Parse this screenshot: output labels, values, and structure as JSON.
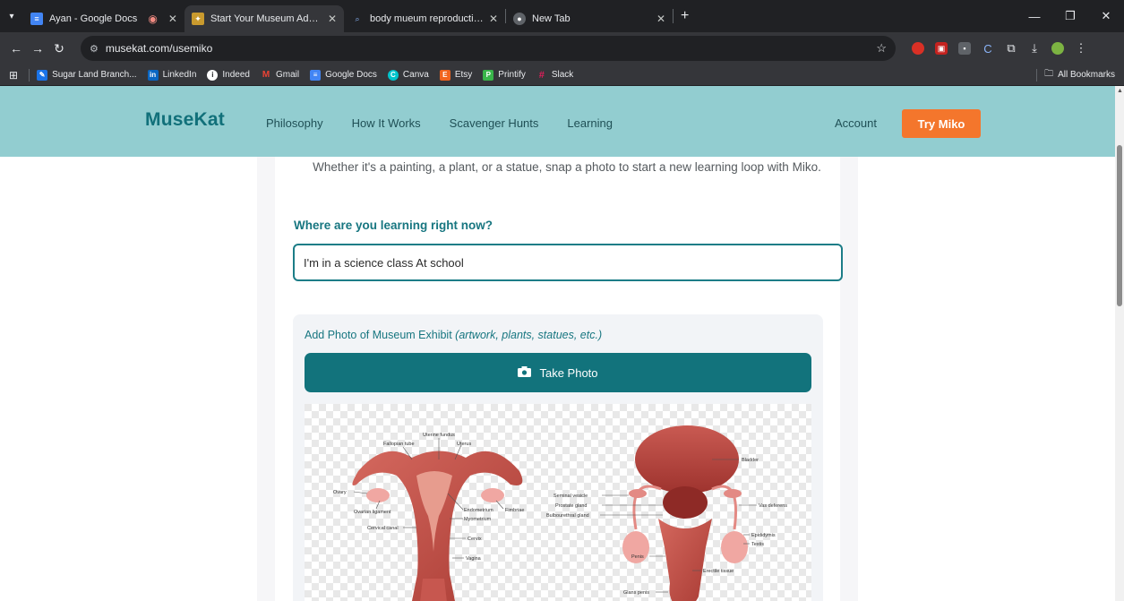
{
  "browser": {
    "tabs": [
      {
        "title": "Ayan - Google Docs",
        "favicon_color": "#4285f4",
        "active": false,
        "recording": true
      },
      {
        "title": "Start Your Museum Adventure",
        "favicon_color": "#c99a2e",
        "active": true
      },
      {
        "title": "body mueum reproductive orga",
        "favicon_color": "#8ab4f8",
        "active": false
      },
      {
        "title": "New Tab",
        "favicon_color": "#9aa0a6",
        "active": false
      }
    ],
    "url": "musekat.com/usemiko",
    "bookmarks": [
      {
        "label": "Sugar Land Branch...",
        "color": "#1a73e8"
      },
      {
        "label": "LinkedIn",
        "color": "#0a66c2"
      },
      {
        "label": "Indeed",
        "color": "#2164f3"
      },
      {
        "label": "Gmail",
        "color": "#ea4335"
      },
      {
        "label": "Google Docs",
        "color": "#4285f4"
      },
      {
        "label": "Canva",
        "color": "#00c4cc"
      },
      {
        "label": "Etsy",
        "color": "#f1641e"
      },
      {
        "label": "Printify",
        "color": "#39b54a"
      },
      {
        "label": "Slack",
        "color": "#e01e5a"
      }
    ],
    "all_bookmarks": "All Bookmarks"
  },
  "site": {
    "logo": "MuseKat",
    "nav": [
      "Philosophy",
      "How It Works",
      "Scavenger Hunts",
      "Learning"
    ],
    "account": "Account",
    "cta": "Try Miko",
    "colors": {
      "header": "#92cdd0",
      "cta": "#f4762c",
      "teal": "#12737c"
    }
  },
  "main": {
    "subtitle": "Whether it's a painting, a plant, or a statue, snap a photo to start a new learning loop with Miko.",
    "location_question": "Where are you learning right now?",
    "location_value": "I'm in a science class At school",
    "photo_label": "Add Photo of Museum Exhibit",
    "photo_label_hint": "(artwork, plants, statues, etc.)",
    "take_photo": "Take Photo"
  },
  "diagram_labels": {
    "female": [
      "Uterine fundus",
      "Fallopian tube",
      "Uterus",
      "Ovary",
      "Ovarian ligament",
      "Endometrium",
      "Fimbriae",
      "Myometrium",
      "Cervical canal",
      "Cervix",
      "Vagina"
    ],
    "male": [
      "Bladder",
      "Seminal vesicle",
      "Prostate gland",
      "Bulbourethral gland",
      "Vas deferens",
      "Epididymis",
      "Testis",
      "Penis",
      "Erectile tissue",
      "Glans penis"
    ]
  }
}
